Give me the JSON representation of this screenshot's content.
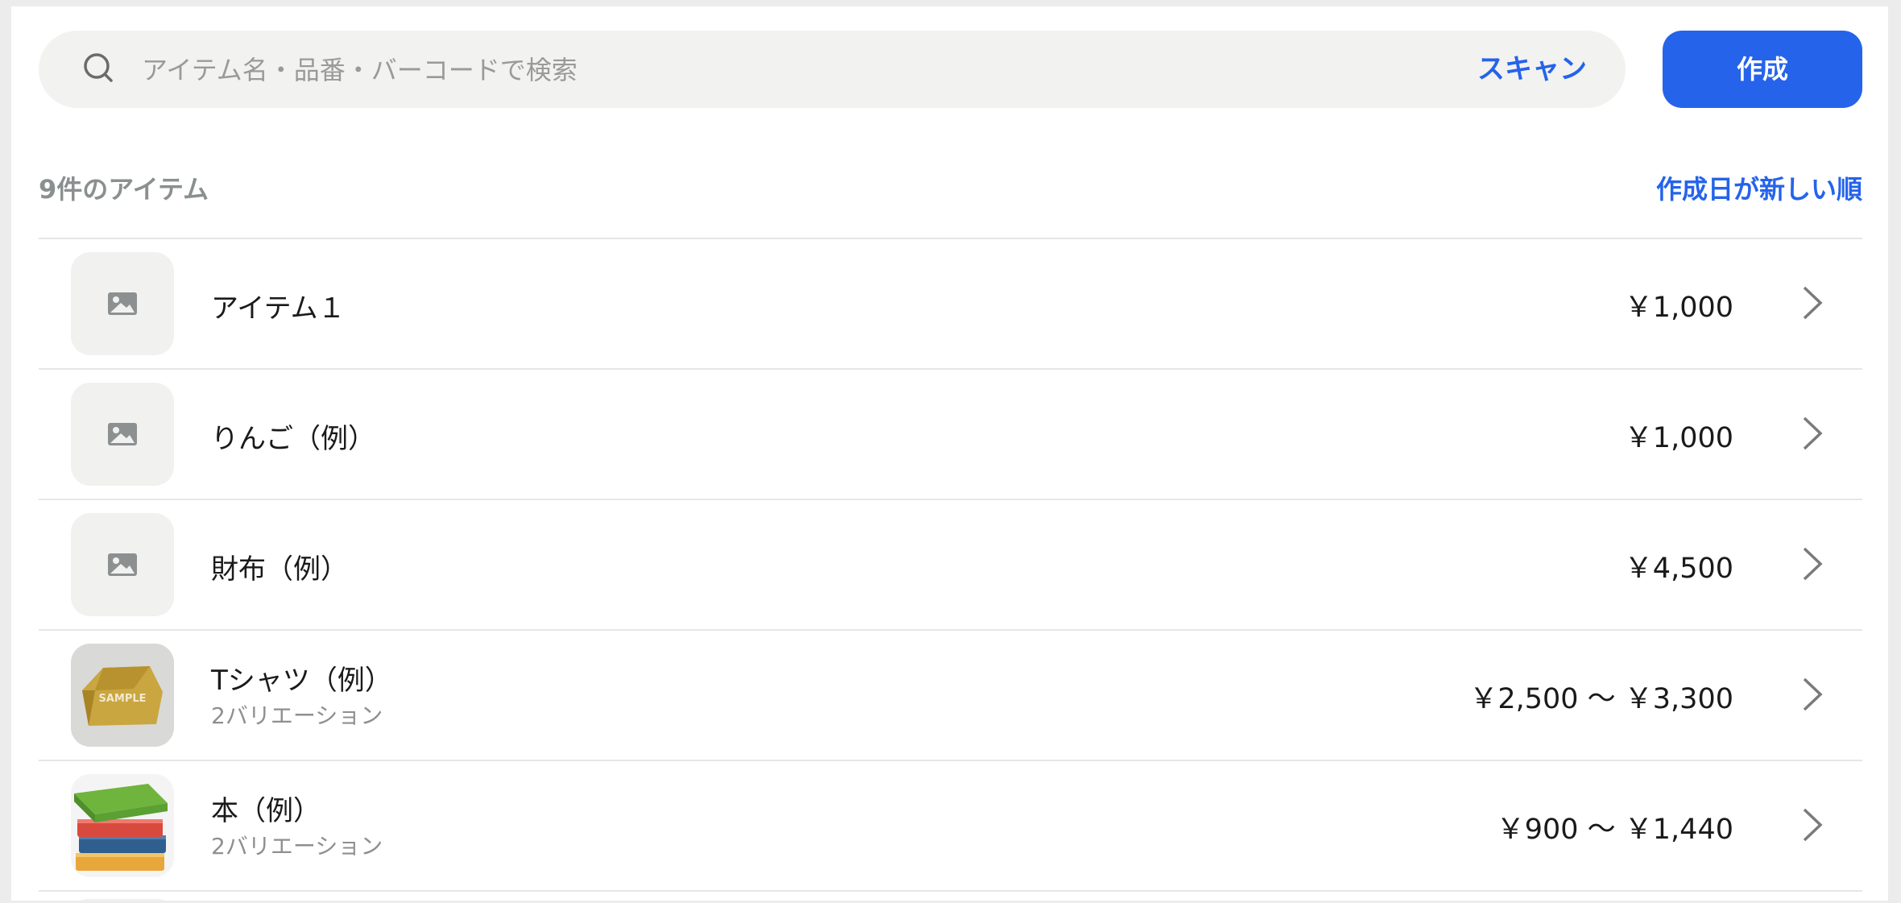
{
  "search": {
    "placeholder": "アイテム名・品番・バーコードで検索",
    "scan_label": "スキャン"
  },
  "toolbar": {
    "create_label": "作成"
  },
  "summary": {
    "count_label": "9件のアイテム",
    "sort_label": "作成日が新しい順"
  },
  "colors": {
    "accent": "#2563eb",
    "placeholder_bg": "#f1f1f0",
    "divider": "#e6e6e6"
  },
  "items": [
    {
      "name": "アイテム１",
      "price": "￥1,000",
      "thumbnail": "image-placeholder-icon"
    },
    {
      "name": "りんご（例）",
      "price": "￥1,000",
      "thumbnail": "image-placeholder-icon"
    },
    {
      "name": "財布（例）",
      "price": "￥4,500",
      "thumbnail": "image-placeholder-icon"
    },
    {
      "name": "Tシャツ（例）",
      "variations": "2バリエーション",
      "price": "￥2,500 〜 ￥3,300",
      "thumbnail": "sample-product-photo",
      "thumbnail_text": "SAMPLE"
    },
    {
      "name": "本（例）",
      "variations": "2バリエーション",
      "price": "￥900 〜 ￥1,440",
      "thumbnail": "book-stack-photo"
    }
  ]
}
